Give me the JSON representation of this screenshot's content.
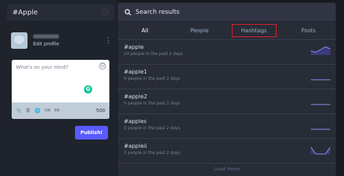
{
  "search": {
    "value": "#Apple"
  },
  "profile": {
    "edit_label": "Edit profile"
  },
  "compose": {
    "placeholder": "What's on your mind?",
    "cw_label": "CW",
    "lang_label": "EN",
    "char_count": "500",
    "publish_label": "Publish!"
  },
  "results": {
    "title": "Search results",
    "tabs": [
      "All",
      "People",
      "Hashtags",
      "Posts"
    ],
    "active_tab": "All",
    "highlighted_tab": "Hashtags",
    "items": [
      {
        "tag": "#apple",
        "sub": "24 people in the past 2 days",
        "trend": [
          6,
          4,
          8,
          12,
          9
        ]
      },
      {
        "tag": "#apple1",
        "sub": "0 people in the past 2 days",
        "trend": [
          0,
          0,
          0,
          0,
          0
        ]
      },
      {
        "tag": "#apple2",
        "sub": "0 people in the past 2 days",
        "trend": [
          0,
          0,
          0,
          0,
          0
        ]
      },
      {
        "tag": "#apples",
        "sub": "0 people in the past 2 days",
        "trend": [
          0,
          0,
          0,
          0,
          0
        ]
      },
      {
        "tag": "#appleii",
        "sub": "2 people in the past 2 days",
        "trend": [
          10,
          0,
          0,
          0,
          10
        ]
      }
    ],
    "load_more": "Load more"
  },
  "colors": {
    "accent": "#595aff",
    "highlight": "#e8202b",
    "grammarly": "#15c39a"
  }
}
